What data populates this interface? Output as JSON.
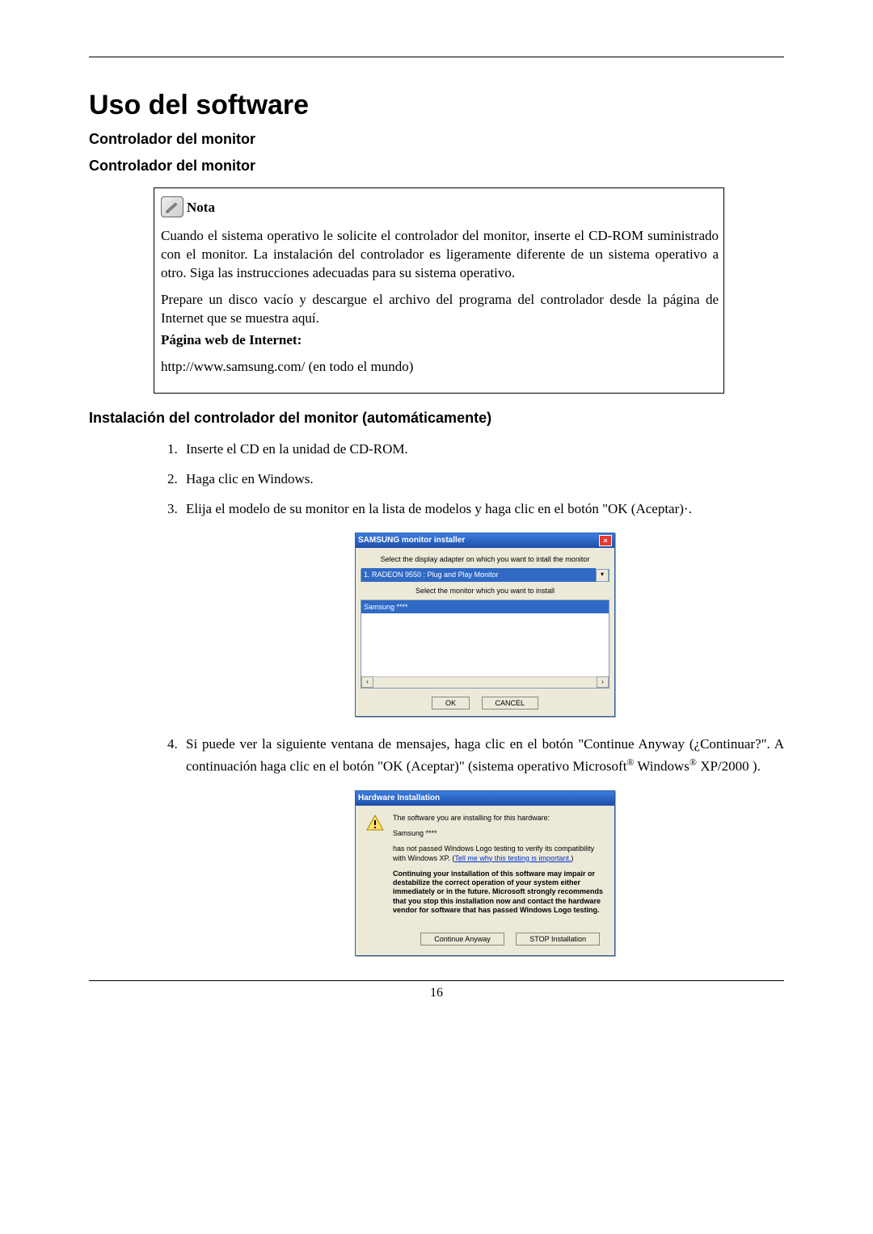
{
  "page": {
    "number": "16",
    "title": "Uso del software",
    "h2a": "Controlador del monitor",
    "h2b": "Controlador del monitor",
    "install_heading": "Instalación del controlador del monitor (automáticamente)"
  },
  "note": {
    "label": "Nota",
    "p1": "Cuando el sistema operativo le solicite el controlador del monitor, inserte el CD-ROM suministrado con el monitor. La instalación del controlador es ligeramente diferente de un sistema operativo a otro. Siga las instrucciones adecuadas para su sistema operativo.",
    "p2": "Prepare un disco vacío y descargue el archivo del programa del controlador desde la página de Internet que se muestra aquí.",
    "web_label": "Página web de Internet:",
    "url": "http://www.samsung.com/ (en todo el mundo)"
  },
  "steps": {
    "s1": "Inserte el CD en la unidad de CD-ROM.",
    "s2": "Haga clic en Windows.",
    "s3": "Elija el modelo de su monitor en la lista de modelos y haga clic en el botón \"OK (Aceptar)·.",
    "s4_a": "Si puede ver la siguiente ventana de mensajes, haga clic en el botón \"Continue Anyway (¿Continuar?\". A continuación haga clic en el botón \"OK (Aceptar)\" (sistema operativo Microsoft",
    "s4_b": " Windows",
    "s4_c": " XP/2000 )."
  },
  "dialog1": {
    "title": "SAMSUNG monitor installer",
    "label1": "Select the display adapter on which you want to intall the monitor",
    "select_value": "1. RADEON 9550 : Plug and Play Monitor",
    "label2": "Select the monitor which you want to install",
    "list_item": "Samsung ****",
    "btn_ok": "OK",
    "btn_cancel": "CANCEL"
  },
  "dialog2": {
    "title": "Hardware Installation",
    "line1": "The software you are installing for this hardware:",
    "line2": "Samsung ****",
    "line3a": "has not passed Windows Logo testing to verify its compatibility with Windows XP. (",
    "line3_link": "Tell me why this testing is important.",
    "line3b": ")",
    "bold_block": "Continuing your installation of this software may impair or destabilize the correct operation of your system either immediately or in the future. Microsoft strongly recommends that you stop this installation now and contact the hardware vendor for software that has passed Windows Logo testing.",
    "btn_continue": "Continue Anyway",
    "btn_stop": "STOP Installation"
  }
}
